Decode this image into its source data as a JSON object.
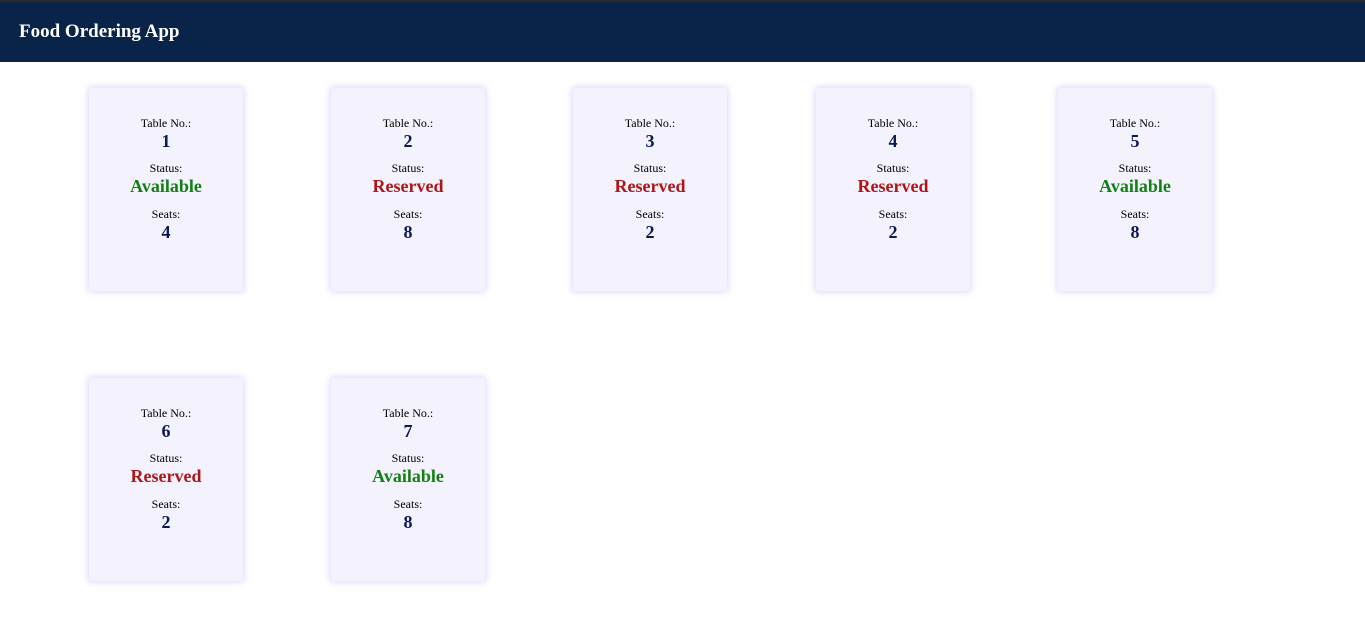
{
  "app": {
    "title": "Food Ordering App",
    "header_color": "#0a2349"
  },
  "labels": {
    "table_no": "Table No.:",
    "status": "Status:",
    "seats": "Seats:"
  },
  "status_colors": {
    "Available": "#128012",
    "Reserved": "#b01616"
  },
  "tables": [
    {
      "number": "1",
      "status": "Available",
      "seats": "4"
    },
    {
      "number": "2",
      "status": "Reserved",
      "seats": "8"
    },
    {
      "number": "3",
      "status": "Reserved",
      "seats": "2"
    },
    {
      "number": "4",
      "status": "Reserved",
      "seats": "2"
    },
    {
      "number": "5",
      "status": "Available",
      "seats": "8"
    },
    {
      "number": "6",
      "status": "Reserved",
      "seats": "2"
    },
    {
      "number": "7",
      "status": "Available",
      "seats": "8"
    }
  ]
}
